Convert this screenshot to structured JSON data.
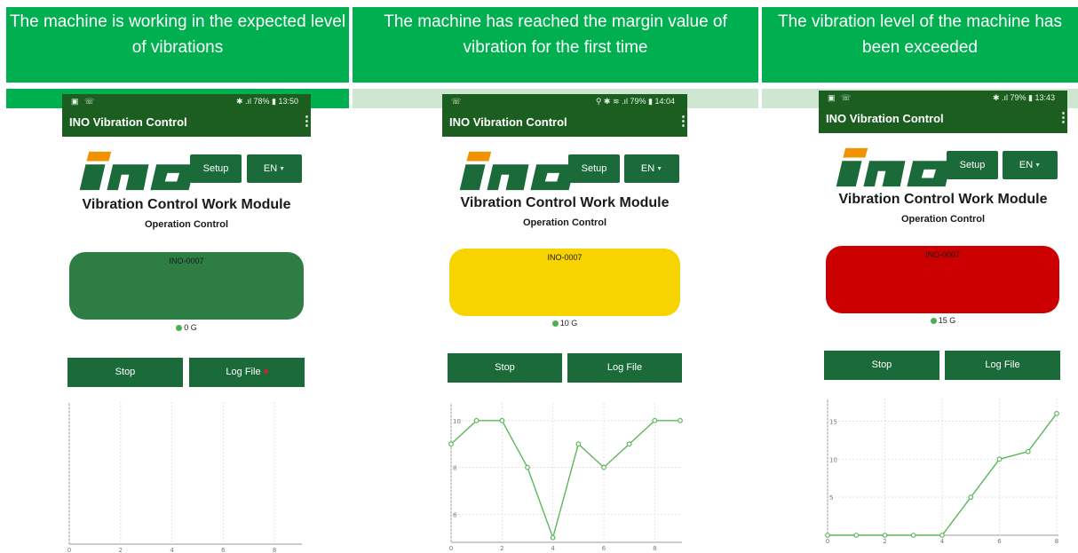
{
  "headers": [
    "The machine is working in the expected level of vibrations",
    "The machine has reached the margin value of vibration for the first time",
    "The vibration level of the machine has been exceeded"
  ],
  "colors": {
    "header_green": "#00b050",
    "band_light": "#cfe6d3",
    "app_bar": "#1b5e20",
    "button_green": "#1b6b3a",
    "normal": "#2e7d44",
    "margin": "#f7d300",
    "exceeded": "#cc0000",
    "line": "#5cb85c"
  },
  "app": {
    "title": "INO Vibration Control",
    "menu_icon": "kebab-menu-icon",
    "setup_label": "Setup",
    "language_label": "EN",
    "heading": "Vibration Control Work Module",
    "subheading": "Operation Control",
    "stop_label": "Stop",
    "log_label": "Log File",
    "machine_id": "INO-0007"
  },
  "panels": [
    {
      "status": "normal",
      "status_bar": {
        "left": "▣ ☏",
        "right": "✱ .ıl 78% ▮ 13:50"
      },
      "reading": "0 G",
      "chart_data": {
        "type": "line",
        "x": [],
        "y": [],
        "xticks": [
          0,
          2,
          4,
          6,
          8
        ],
        "yticks": [],
        "xlim": [
          0,
          9
        ],
        "ylim": [
          0,
          16
        ],
        "grid": true
      }
    },
    {
      "status": "margin",
      "status_bar": {
        "left": "☏",
        "right": "⚲ ✱ ≋ .ıl 79% ▮ 14:04"
      },
      "reading": "10 G",
      "chart_data": {
        "type": "line",
        "x": [
          0,
          1,
          2,
          3,
          4,
          5,
          6,
          7,
          8,
          9
        ],
        "y": [
          9,
          10,
          10,
          8,
          5,
          9,
          8,
          9,
          10,
          10
        ],
        "xticks": [
          0,
          2,
          4,
          6,
          8
        ],
        "yticks": [
          6,
          8,
          10
        ],
        "xlim": [
          0,
          9
        ],
        "ylim": [
          4.8,
          10.6
        ],
        "grid": true
      }
    },
    {
      "status": "exceeded",
      "status_bar": {
        "left": "▣ ☏",
        "right": "✱ .ıl 79% ▮ 13:43"
      },
      "reading": "15 G",
      "chart_data": {
        "type": "line",
        "x": [
          0,
          1,
          2,
          3,
          4,
          5,
          6,
          7,
          8
        ],
        "y": [
          0,
          0,
          0,
          0,
          0,
          5,
          10,
          11,
          16
        ],
        "xticks": [
          0,
          2,
          4,
          6,
          8
        ],
        "yticks": [
          5,
          10,
          15
        ],
        "xlim": [
          0,
          8
        ],
        "ylim": [
          0,
          17.5
        ],
        "grid": true
      }
    }
  ]
}
